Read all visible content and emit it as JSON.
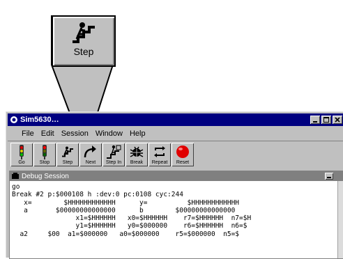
{
  "callout": {
    "step_label": "Step"
  },
  "window": {
    "title": "Sim5630…",
    "menu": [
      "File",
      "Edit",
      "Session",
      "Window",
      "Help"
    ]
  },
  "toolbar": {
    "buttons": [
      {
        "label": "Go",
        "icon": "traffic-light-icon"
      },
      {
        "label": "Stop",
        "icon": "traffic-light-red-icon"
      },
      {
        "label": "Step",
        "icon": "step-climber-icon"
      },
      {
        "label": "Next",
        "icon": "next-arrow-icon"
      },
      {
        "label": "Step In",
        "icon": "step-in-icon"
      },
      {
        "label": "Break",
        "icon": "bug-icon"
      },
      {
        "label": "Repeat",
        "icon": "repeat-icon"
      },
      {
        "label": "Reset",
        "icon": "reset-red-circle-icon"
      }
    ]
  },
  "session": {
    "title": "Debug Session",
    "lines": [
      "go",
      "Break #2 p:$000108 h :dev:0 pc:0108 cyc:244",
      "   x=        $HHHHHHHHHHHH      y=          $HHHHHHHHHHHH",
      "   a       $00000000000000      b        $00000000000000",
      "                x1=$HHHHHH   x0=$HHHHHH    r7=$HHHHHH  n7=$H",
      "                y1=$HHHHHH   y0=$000000    r6=$HHHHHH  n6=$",
      "  a2     $00  a1=$000000   a0=$000000    r5=$000000  n5=$"
    ]
  },
  "colors": {
    "titlebar": "#000080",
    "window_bg": "#c0c0c0",
    "reset_red": "#e00000"
  }
}
